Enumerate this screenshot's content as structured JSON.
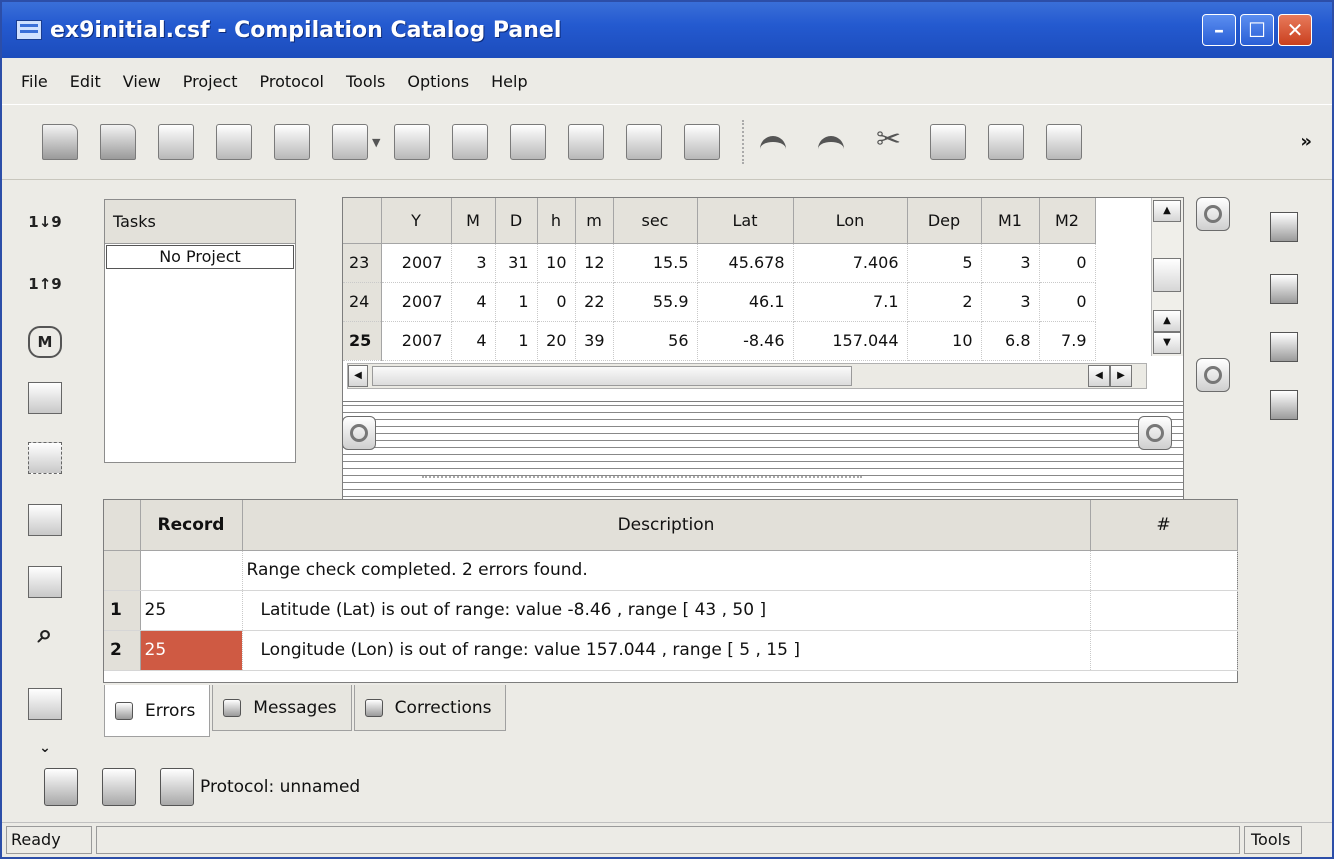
{
  "window": {
    "title": "ex9initial.csf - Compilation Catalog Panel"
  },
  "menu": [
    "File",
    "Edit",
    "View",
    "Project",
    "Protocol",
    "Tools",
    "Options",
    "Help"
  ],
  "toolbar_more": "»",
  "tasks": {
    "header": "Tasks",
    "item": "No Project"
  },
  "left_icons": {
    "a1": "1",
    "a2": "9",
    "b1": "1",
    "b2": "9",
    "m": "M"
  },
  "data_grid": {
    "columns": [
      "",
      "Y",
      "M",
      "D",
      "h",
      "m",
      "sec",
      "Lat",
      "Lon",
      "Dep",
      "M1",
      "M2"
    ],
    "rows": [
      [
        "23",
        "2007",
        "3",
        "31",
        "10",
        "12",
        "15.5",
        "45.678",
        "7.406",
        "5",
        "3",
        "0"
      ],
      [
        "24",
        "2007",
        "4",
        "1",
        "0",
        "22",
        "55.9",
        "46.1",
        "7.1",
        "2",
        "3",
        "0"
      ],
      [
        "25",
        "2007",
        "4",
        "1",
        "20",
        "39",
        "56",
        "-8.46",
        "157.044",
        "10",
        "6.8",
        "7.9"
      ]
    ]
  },
  "errors": {
    "columns": [
      "",
      "Record",
      "Description",
      "#"
    ],
    "summary": "Range check completed. 2 errors found.",
    "rows": [
      {
        "num": "1",
        "record": "25",
        "description": "Latitude (Lat) is out of range: value -8.46 , range [ 43 , 50 ]"
      },
      {
        "num": "2",
        "record": "25",
        "description": "Longitude (Lon) is out of range: value 157.044 , range [ 5 , 15 ]"
      }
    ]
  },
  "tabs": [
    "Errors",
    "Messages",
    "Corrections"
  ],
  "protocol": "Protocol: unnamed",
  "status": {
    "left": "Ready",
    "right": "Tools"
  },
  "colors": {
    "titlebar": "#245ad0",
    "selected_record": "#cf5a43",
    "panel": "#ecebe6"
  }
}
